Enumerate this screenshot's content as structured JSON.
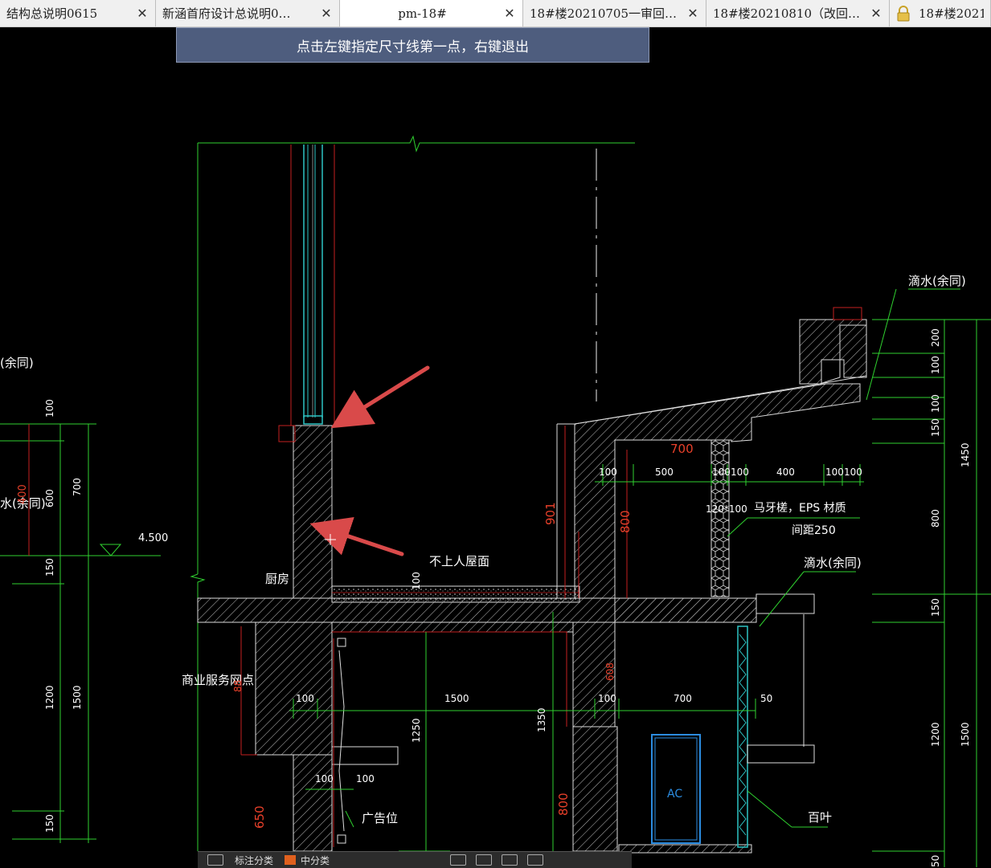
{
  "tabs": [
    {
      "label": "结构总说明0615",
      "width": 194
    },
    {
      "label": "新涵首府设计总说明0…",
      "width": 229
    },
    {
      "label": "pm-18#",
      "width": 228
    },
    {
      "label": "18#楼20210705一审回…",
      "width": 228
    },
    {
      "label": "18#楼20210810（改回…",
      "width": 228
    },
    {
      "label": "18#楼2021(",
      "width": 140
    }
  ],
  "hint": "点击左键指定尺寸线第一点，右键退出",
  "labels": {
    "drip_top_right": "滴水(余同)",
    "drip_left_top": "(余同)",
    "drip_left_mid": "水(余同)",
    "drip_right_mid": "滴水(余同)",
    "roof": "不上人屋面",
    "kitchen": "厨房",
    "commerce": "商业服务网点",
    "brick": "马牙槎，EPS 材质",
    "spacing": "间距250",
    "ad": "广告位",
    "louver": "百叶",
    "ac": "AC",
    "elev": "4.500"
  },
  "dims": {
    "d100a": "100",
    "d500": "500",
    "d100b": "100",
    "d100c": "100",
    "d400": "400",
    "d100d": "100",
    "d100e": "100",
    "d700top": "700",
    "d120": "120*100",
    "d901": "901",
    "d800": "800",
    "d100f": "100",
    "d1500": "1500",
    "d100g": "100",
    "d700": "700",
    "d50": "50",
    "d1250": "1250",
    "d1350": "1350",
    "d800b": "800",
    "d650": "650",
    "d100h": "100",
    "d100i": "100",
    "r200": "200",
    "r100a": "100",
    "r100b": "100",
    "r150a": "150",
    "r1450": "1450",
    "r800": "800",
    "r150b": "150",
    "r1200": "1200",
    "r1500": "1500",
    "r50": "50",
    "l100": "100",
    "l700": "700",
    "l600": "600",
    "l150": "150",
    "l1200": "1200",
    "l1500": "1500",
    "l150b": "150",
    "d100wall": "100",
    "d88": "88",
    "d608": "608",
    "d400red": "400"
  },
  "toolbar": {
    "field1": "标注分类",
    "field2": "中分类"
  }
}
